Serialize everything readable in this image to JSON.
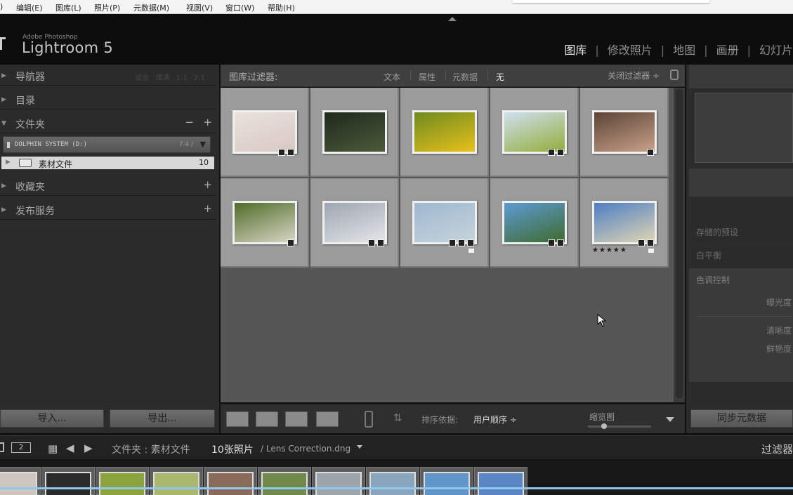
{
  "menubar": {
    "items": [
      ")",
      "编辑(E)",
      "图库(L)",
      "照片(P)",
      "元数据(M)",
      "视图(V)",
      "窗口(W)",
      "帮助(H)"
    ]
  },
  "identity": {
    "brand_small": "Adobe Photoshop",
    "brand_name": "Lightroom 5",
    "modules": [
      "图库",
      "修改照片",
      "地图",
      "画册",
      "幻灯片"
    ],
    "active_module": "图库",
    "separator": "|"
  },
  "left_panel": {
    "navigator": {
      "title": "导航器",
      "options": "适合 填满 1:1 2:1"
    },
    "catalog": {
      "title": "目录"
    },
    "folders": {
      "title": "文件夹",
      "minus": "−",
      "plus": "+",
      "volume": {
        "name": "DOLPHIN SYSTEM (D:)",
        "size": "7.4 / "
      },
      "folder": {
        "name": "素材文件",
        "count": "10"
      }
    },
    "collections": {
      "title": "收藏夹",
      "plus": "+"
    },
    "publish": {
      "title": "发布服务",
      "plus": "+"
    },
    "import_label": "导入...",
    "export_label": "导出..."
  },
  "filter_bar": {
    "label": "图库过滤器:",
    "options": [
      "文本",
      "属性",
      "元数据",
      "无"
    ],
    "active": "无",
    "close_label": "关闭过滤器 ÷"
  },
  "grid": {
    "cells": [
      {
        "colors": [
          "#eae2dc",
          "#d8c8c2"
        ],
        "badges": 2,
        "flag": false,
        "stars": ""
      },
      {
        "colors": [
          "#1f2a1c",
          "#4b5a3a"
        ],
        "badges": 0,
        "flag": false,
        "stars": ""
      },
      {
        "colors": [
          "#6f8a1f",
          "#e7c11c"
        ],
        "badges": 0,
        "flag": false,
        "stars": ""
      },
      {
        "colors": [
          "#cfe0f0",
          "#93ad3a"
        ],
        "badges": 2,
        "flag": false,
        "stars": ""
      },
      {
        "colors": [
          "#5b4436",
          "#c9a18a"
        ],
        "badges": 1,
        "flag": false,
        "stars": ""
      },
      {
        "colors": [
          "#4f6c28",
          "#d9d6c6"
        ],
        "badges": 1,
        "flag": false,
        "stars": ""
      },
      {
        "colors": [
          "#9da6b0",
          "#e4e6ea"
        ],
        "badges": 2,
        "flag": false,
        "stars": ""
      },
      {
        "colors": [
          "#9fb8cf",
          "#c6d4dc"
        ],
        "badges": 3,
        "flag": true,
        "stars": ""
      },
      {
        "colors": [
          "#5c9bd4",
          "#3f6b2e"
        ],
        "badges": 2,
        "flag": false,
        "stars": ""
      },
      {
        "colors": [
          "#4d7ec4",
          "#e1d6b4"
        ],
        "badges": 2,
        "flag": true,
        "stars": "★★★★★"
      }
    ]
  },
  "toolbar": {
    "sort_label": "排序依据:",
    "sort_value": "用户顺序 ÷",
    "thumb_label": "缩览图",
    "thumb_size_fraction": 0.25
  },
  "right_panel": {
    "saved_preset": "存储的预设",
    "white_balance": "白平衡",
    "tone_control": "色调控制",
    "exposure": "曝光度",
    "clarity": "清晰度",
    "vibrance": "鲜艳度",
    "sync_label": "同步元数据"
  },
  "filmstrip": {
    "page1": "1",
    "page2": "2",
    "path": "文件夹 : 素材文件",
    "count": "10张照片",
    "file": "/ Lens Correction.dng",
    "filter": "过滤器",
    "thumbs": [
      "#cfc6c0",
      "#2a2a2a",
      "#8ca23a",
      "#a9b86c",
      "#8a6a5a",
      "#6f8a4a",
      "#9ea4ac",
      "#8aa6bd",
      "#5f95c9",
      "#5b86c6"
    ]
  }
}
